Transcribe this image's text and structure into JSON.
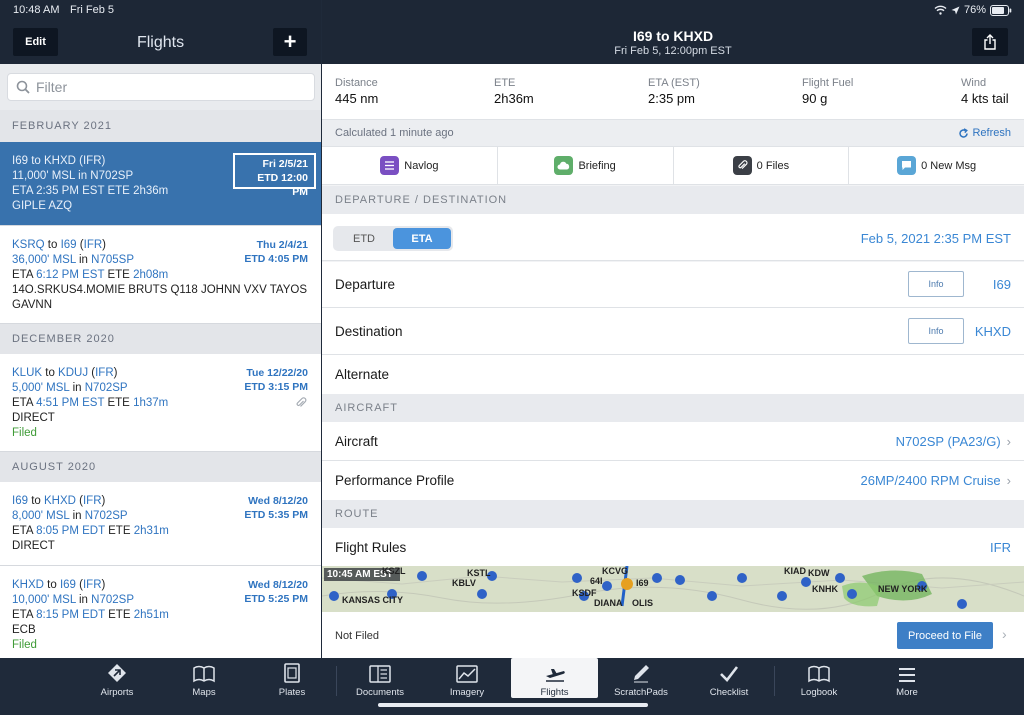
{
  "status": {
    "time": "10:48 AM",
    "date": "Fri Feb 5",
    "battery": "76%"
  },
  "left": {
    "edit_label": "Edit",
    "title": "Flights",
    "add_label": "+",
    "filter_placeholder": "Filter",
    "sections": [
      {
        "label": "FEBRUARY 2021"
      },
      {
        "label": "DECEMBER 2020"
      },
      {
        "label": "AUGUST 2020"
      }
    ],
    "flights": [
      {
        "from": "I69",
        "to_word": "to",
        "dest": "KHXD",
        "rules": "IFR",
        "alt": "11,000' MSL",
        "in_word": "in",
        "tail": "N702SP",
        "eta_label": "ETA",
        "eta": "2:35 PM EST",
        "ete_label": "ETE",
        "ete": "2h36m",
        "route": "GIPLE AZQ",
        "status": "",
        "date_line1": "Fri 2/5/21",
        "date_line2": "ETD 12:00 PM"
      },
      {
        "from": "KSRQ",
        "to_word": "to",
        "dest": "I69",
        "rules": "IFR",
        "alt": "36,000' MSL",
        "in_word": "in",
        "tail": "N705SP",
        "eta_label": "ETA",
        "eta": "6:12 PM EST",
        "ete_label": "ETE",
        "ete": "2h08m",
        "route": "14O.SRKUS4.MOMIE BRUTS Q118 JOHNN VXV TAYOS GAVNN",
        "status": "",
        "date_line1": "Thu 2/4/21",
        "date_line2": "ETD 4:05 PM"
      },
      {
        "from": "KLUK",
        "to_word": "to",
        "dest": "KDUJ",
        "rules": "IFR",
        "alt": "5,000' MSL",
        "in_word": "in",
        "tail": "N702SP",
        "eta_label": "ETA",
        "eta": "4:51 PM EST",
        "ete_label": "ETE",
        "ete": "1h37m",
        "route": "DIRECT",
        "status": "Filed",
        "date_line1": "Tue 12/22/20",
        "date_line2": "ETD 3:15 PM"
      },
      {
        "from": "I69",
        "to_word": "to",
        "dest": "KHXD",
        "rules": "IFR",
        "alt": "8,000' MSL",
        "in_word": "in",
        "tail": "N702SP",
        "eta_label": "ETA",
        "eta": "8:05 PM EDT",
        "ete_label": "ETE",
        "ete": "2h31m",
        "route": "DIRECT",
        "status": "",
        "date_line1": "Wed 8/12/20",
        "date_line2": "ETD 5:35 PM"
      },
      {
        "from": "KHXD",
        "to_word": "to",
        "dest": "I69",
        "rules": "IFR",
        "alt": "10,000' MSL",
        "in_word": "in",
        "tail": "N702SP",
        "eta_label": "ETA",
        "eta": "8:15 PM EDT",
        "ete_label": "ETE",
        "ete": "2h51m",
        "route": "ECB",
        "status": "Filed",
        "date_line1": "Wed 8/12/20",
        "date_line2": "ETD 5:25 PM"
      }
    ]
  },
  "right": {
    "title": "I69 to KHXD",
    "subtitle": "Fri Feb 5, 12:00pm EST",
    "stats": [
      {
        "label": "Distance",
        "value": "445 nm"
      },
      {
        "label": "ETE",
        "value": "2h36m"
      },
      {
        "label": "ETA (EST)",
        "value": "2:35 pm"
      },
      {
        "label": "Flight Fuel",
        "value": "90 g"
      },
      {
        "label": "Wind",
        "value": "4 kts tail"
      }
    ],
    "calculated": "Calculated 1 minute ago",
    "refresh": "Refresh",
    "tabs": [
      {
        "label": "Navlog",
        "color": "#7a4fc2"
      },
      {
        "label": "Briefing",
        "color": "#5fae6a"
      },
      {
        "label": "0 Files",
        "color": "#3b3f46"
      },
      {
        "label": "0 New Msg",
        "color": "#5aa6d6"
      }
    ],
    "section_dep_dest": "DEPARTURE / DESTINATION",
    "seg_etd": "ETD",
    "seg_eta": "ETA",
    "eta_value": "Feb 5, 2021 2:35 PM EST",
    "departure_label": "Departure",
    "departure_value": "I69",
    "destination_label": "Destination",
    "destination_value": "KHXD",
    "info_label": "Info",
    "alternate_label": "Alternate",
    "section_aircraft": "AIRCRAFT",
    "aircraft_label": "Aircraft",
    "aircraft_value": "N702SP (PA23/G)",
    "perf_label": "Performance Profile",
    "perf_value": "26MP/2400 RPM Cruise",
    "section_route": "ROUTE",
    "flight_rules_label": "Flight Rules",
    "flight_rules_value": "IFR",
    "map_time": "10:45 AM EST",
    "map_labels": [
      "KSZL",
      "KSTL",
      "KBLV",
      "KANSAS CITY",
      "64I",
      "KCVG",
      "I69",
      "KSDF",
      "DIANA",
      "OLIS",
      "KIAD",
      "KDW",
      "KNHK",
      "NEW YORK"
    ],
    "not_filed": "Not Filed",
    "proceed": "Proceed to File"
  },
  "nav": [
    {
      "label": "Airports",
      "icon": "airports-icon"
    },
    {
      "label": "Maps",
      "icon": "maps-icon"
    },
    {
      "label": "Plates",
      "icon": "plates-icon"
    },
    {
      "label": "Documents",
      "icon": "documents-icon"
    },
    {
      "label": "Imagery",
      "icon": "imagery-icon"
    },
    {
      "label": "Flights",
      "icon": "flights-icon",
      "active": true
    },
    {
      "label": "ScratchPads",
      "icon": "scratchpads-icon"
    },
    {
      "label": "Checklist",
      "icon": "checklist-icon"
    },
    {
      "label": "Logbook",
      "icon": "logbook-icon"
    },
    {
      "label": "More",
      "icon": "more-icon"
    }
  ]
}
